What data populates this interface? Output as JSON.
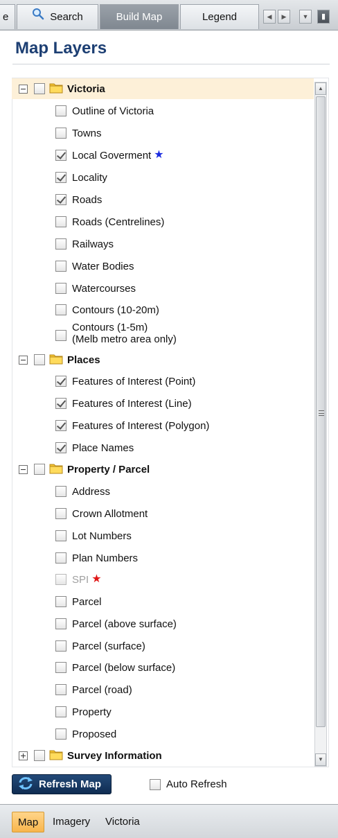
{
  "tabs": {
    "partial_label": "e",
    "search_label": "Search",
    "build_label": "Build Map",
    "legend_label": "Legend"
  },
  "panel": {
    "title": "Map Layers"
  },
  "groups": {
    "victoria": {
      "label": "Victoria",
      "expanded": true,
      "layers": [
        {
          "label": "Outline of Victoria",
          "checked": false
        },
        {
          "label": "Towns",
          "checked": false
        },
        {
          "label": "Local Goverment",
          "checked": true,
          "star": "blue"
        },
        {
          "label": "Locality",
          "checked": true
        },
        {
          "label": "Roads",
          "checked": true
        },
        {
          "label": "Roads (Centrelines)",
          "checked": false
        },
        {
          "label": "Railways",
          "checked": false
        },
        {
          "label": "Water Bodies",
          "checked": false
        },
        {
          "label": "Watercourses",
          "checked": false
        },
        {
          "label": "Contours (10-20m)",
          "checked": false
        },
        {
          "label": "Contours (1-5m)",
          "label2": "(Melb metro area only)",
          "checked": false
        }
      ]
    },
    "places": {
      "label": "Places",
      "expanded": true,
      "layers": [
        {
          "label": "Features of Interest (Point)",
          "checked": true
        },
        {
          "label": "Features of Interest (Line)",
          "checked": true
        },
        {
          "label": "Features of Interest (Polygon)",
          "checked": true
        },
        {
          "label": "Place Names",
          "checked": true
        }
      ]
    },
    "property": {
      "label": "Property / Parcel",
      "expanded": true,
      "layers": [
        {
          "label": "Address",
          "checked": false
        },
        {
          "label": "Crown Allotment",
          "checked": false
        },
        {
          "label": "Lot Numbers",
          "checked": false
        },
        {
          "label": "Plan Numbers",
          "checked": false
        },
        {
          "label": "SPI",
          "checked": false,
          "disabled": true,
          "star": "red"
        },
        {
          "label": "Parcel",
          "checked": false
        },
        {
          "label": "Parcel (above surface)",
          "checked": false
        },
        {
          "label": "Parcel (surface)",
          "checked": false
        },
        {
          "label": "Parcel (below surface)",
          "checked": false
        },
        {
          "label": "Parcel (road)",
          "checked": false
        },
        {
          "label": "Property",
          "checked": false
        },
        {
          "label": "Proposed",
          "checked": false
        }
      ]
    },
    "survey": {
      "label": "Survey Information",
      "expanded": false
    }
  },
  "controls": {
    "refresh_label": "Refresh Map",
    "auto_refresh_label": "Auto Refresh",
    "auto_refresh_checked": false
  },
  "bottom_tabs": [
    {
      "label": "Map",
      "active": true
    },
    {
      "label": "Imagery",
      "active": false
    },
    {
      "label": "Victoria",
      "active": false
    }
  ],
  "icons": {
    "search": "magnifier-icon",
    "folder": "folder-icon",
    "refresh": "refresh-icon",
    "star": "star-icon"
  },
  "colors": {
    "title": "#1d3f73",
    "group_highlight": "#fdf0d8",
    "refresh_button": "#1a3c66",
    "active_tab": "#f8b54c",
    "star_blue": "#1b2be0",
    "star_red": "#e01717"
  }
}
